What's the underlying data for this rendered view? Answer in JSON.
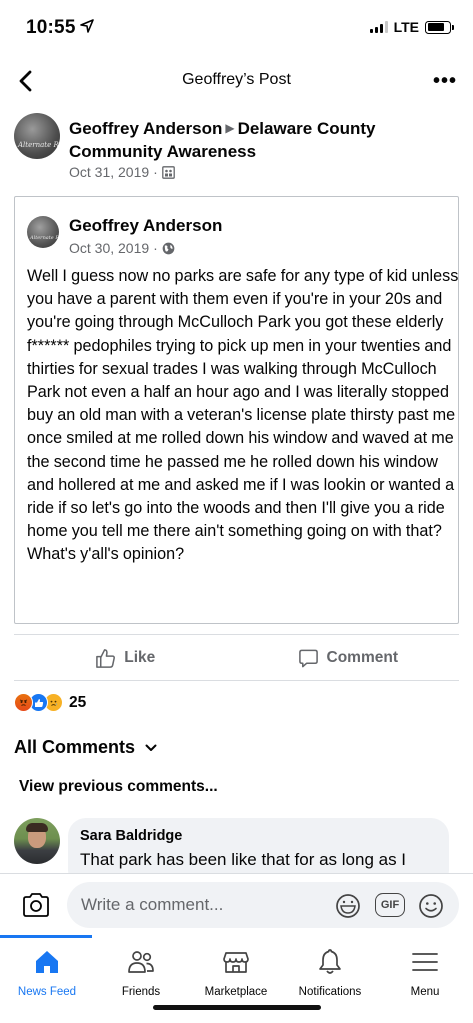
{
  "status_bar": {
    "time": "10:55",
    "network": "LTE",
    "battery_level": 0.78
  },
  "header": {
    "title": "Geoffrey’s Post"
  },
  "post": {
    "author": "Geoffrey Anderson",
    "group": "Delaware County Community Awareness",
    "date": "Oct 31, 2019",
    "audience_icon": "group-icon"
  },
  "shared_post": {
    "author": "Geoffrey Anderson",
    "date": "Oct 30, 2019",
    "audience_icon": "globe-icon",
    "body": "Well I guess now no parks are safe for any type of kid unless you have a parent with them even if you're in your 20s and you're going through McCulloch Park you got these elderly f****** pedophiles trying to pick up men in your twenties and thirties for sexual trades I was walking through McCulloch Park not even a half an hour ago and I was literally stopped buy an old man with a veteran's license plate thirsty past me once smiled at me rolled down his window and waved at me the second time he passed me he rolled down his window and hollered at me and asked me if I was lookin or wanted a ride if so let's go into the woods and then I'll give you a ride home you  tell me there ain't something going on with that? What's y'all's opinion?"
  },
  "actions": {
    "like_label": "Like",
    "comment_label": "Comment"
  },
  "reactions": {
    "types": [
      "angry",
      "like",
      "sad"
    ],
    "count": "25"
  },
  "comments_section": {
    "title": "All Comments",
    "view_previous": "View previous comments..."
  },
  "comments": [
    {
      "name": "Sara Baldridge",
      "text": "That park has been like that for as long as I"
    }
  ],
  "composer": {
    "placeholder": "Write a comment...",
    "gif_label": "GIF"
  },
  "tabs": [
    {
      "label": "News Feed",
      "icon": "home-icon",
      "active": true
    },
    {
      "label": "Friends",
      "icon": "friends-icon",
      "active": false
    },
    {
      "label": "Marketplace",
      "icon": "marketplace-icon",
      "active": false
    },
    {
      "label": "Notifications",
      "icon": "bell-icon",
      "active": false
    },
    {
      "label": "Menu",
      "icon": "menu-icon",
      "active": false
    }
  ],
  "colors": {
    "accent": "#1877f2",
    "secondary_text": "#65676b",
    "bubble": "#f0f2f5"
  }
}
